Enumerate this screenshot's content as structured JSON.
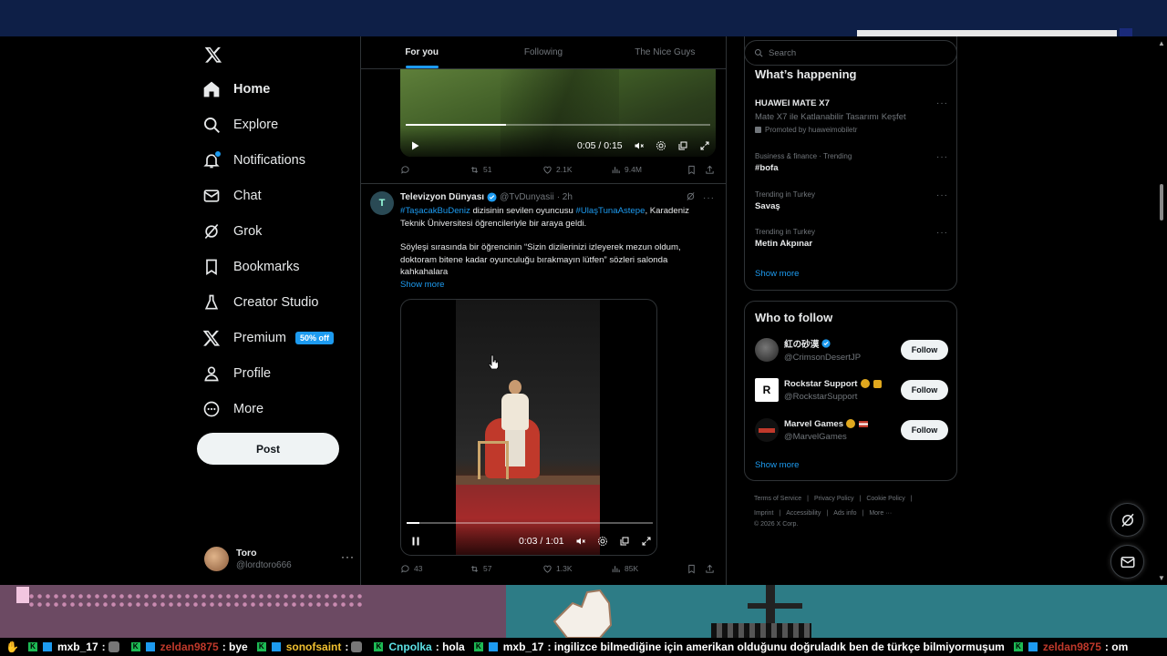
{
  "nav": {
    "items": [
      {
        "label": "Home",
        "icon": "home-icon"
      },
      {
        "label": "Explore",
        "icon": "search-icon"
      },
      {
        "label": "Notifications",
        "icon": "bell-icon"
      },
      {
        "label": "Chat",
        "icon": "mail-icon"
      },
      {
        "label": "Grok",
        "icon": "grok-icon"
      },
      {
        "label": "Bookmarks",
        "icon": "bookmark-icon"
      },
      {
        "label": "Creator Studio",
        "icon": "flask-icon"
      },
      {
        "label": "Premium",
        "icon": "x-icon"
      },
      {
        "label": "Profile",
        "icon": "person-icon"
      },
      {
        "label": "More",
        "icon": "more-circle-icon"
      }
    ],
    "premium_badge": "50% off",
    "post_label": "Post",
    "account": {
      "name": "Toro",
      "handle": "@lordtoro666"
    }
  },
  "tabs": [
    "For you",
    "Following",
    "The Nice Guys"
  ],
  "tweet1": {
    "time": "0:05 / 0:15",
    "progress": 0.33,
    "reposts": "51",
    "likes": "2.1K",
    "views": "9.4M"
  },
  "tweet2": {
    "display_name": "Televizyon Dünyası",
    "handle": "@TvDunyasii",
    "age": "· 2h",
    "hashtag1": "#TaşacakBuDeniz",
    "text1": " dizisinin sevilen oyuncusu ",
    "hashtag2": "#UlaşTunaAstepe",
    "text2": ", Karadeniz Teknik Üniversitesi öğrencileriyle bir araya geldi.",
    "text3": "Söyleşi sırasında bir öğrencinin “Sizin dizilerinizi izleyerek mezun oldum, doktoram bitene kadar oyunculuğu bırakmayın lütfen” sözleri salonda kahkahalara",
    "show_more": "Show more",
    "time": "0:03 / 1:01",
    "progress": 0.05,
    "replies": "43",
    "reposts": "57",
    "likes": "1.3K",
    "views": "85K"
  },
  "search": {
    "placeholder": "Search"
  },
  "happening": {
    "title": "What’s happening",
    "promo": {
      "name": "HUAWEI MATE X7",
      "desc": "Mate X7 ile Katlanabilir Tasarımı Keşfet",
      "promoted": "Promoted by huaweimobiletr"
    },
    "trends": [
      {
        "meta": "Business & finance · Trending",
        "name": "#bofa"
      },
      {
        "meta": "Trending in Turkey",
        "name": "Savaş"
      },
      {
        "meta": "Trending in Turkey",
        "name": "Metin Akpınar"
      }
    ],
    "show_more": "Show more"
  },
  "who_to_follow": {
    "title": "Who to follow",
    "accounts": [
      {
        "name": "紅の砂漠",
        "handle": "@CrimsonDesertJP"
      },
      {
        "name": "Rockstar Support",
        "handle": "@RockstarSupport"
      },
      {
        "name": "Marvel Games",
        "handle": "@MarvelGames"
      }
    ],
    "follow_label": "Follow",
    "show_more": "Show more"
  },
  "footer": {
    "links": [
      "Terms of Service",
      "|",
      "Privacy Policy",
      "|",
      "Cookie Policy",
      "|",
      "Imprint",
      "|",
      "Accessibility",
      "|",
      "Ads info",
      "|",
      "More ···"
    ],
    "copyright": "© 2026 X Corp."
  },
  "ticker": [
    {
      "user": "mxb_17",
      "msg": ": "
    },
    {
      "user": "zeldan9875",
      "msg": ": bye",
      "red": true
    },
    {
      "user": "sonofsaint",
      "msg": ": "
    },
    {
      "user": "Cnpolka",
      "msg": ": hola"
    },
    {
      "user": "mxb_17",
      "msg": ": ingilizce bilmediğine için amerikan olduğunu doğruladık  ben de türkçe bilmiyormuşum"
    },
    {
      "user": "zeldan9875",
      "msg": ": om",
      "red": true
    }
  ],
  "colors": {
    "accent": "#1d9bf0",
    "background": "#000000",
    "border": "#2f3336"
  }
}
